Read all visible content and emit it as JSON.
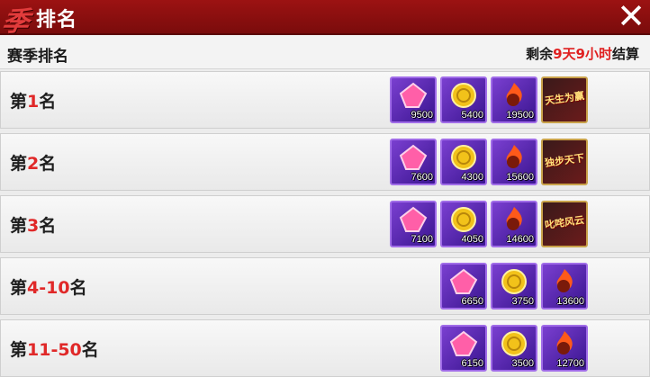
{
  "header": {
    "logo_char": "季",
    "title": "排名",
    "close_icon": "close-icon"
  },
  "subheader": {
    "label": "赛季排名",
    "remain_prefix": "剩余",
    "remain_days": "9天",
    "remain_hours": "9小时",
    "remain_suffix": "结算"
  },
  "rows": [
    {
      "rank_prefix": "第",
      "rank_num": "1",
      "rank_suffix": "名",
      "items": [
        {
          "icon": "pink-crystal-icon",
          "count": "9500"
        },
        {
          "icon": "gold-coin-icon",
          "count": "5400"
        },
        {
          "icon": "fire-orb-icon",
          "count": "19500"
        }
      ],
      "title_badge": "天生为赢"
    },
    {
      "rank_prefix": "第",
      "rank_num": "2",
      "rank_suffix": "名",
      "items": [
        {
          "icon": "pink-crystal-icon",
          "count": "7600"
        },
        {
          "icon": "gold-coin-icon",
          "count": "4300"
        },
        {
          "icon": "fire-orb-icon",
          "count": "15600"
        }
      ],
      "title_badge": "独步天下"
    },
    {
      "rank_prefix": "第",
      "rank_num": "3",
      "rank_suffix": "名",
      "items": [
        {
          "icon": "pink-crystal-icon",
          "count": "7100"
        },
        {
          "icon": "gold-coin-icon",
          "count": "4050"
        },
        {
          "icon": "fire-orb-icon",
          "count": "14600"
        }
      ],
      "title_badge": "叱咤风云"
    },
    {
      "rank_prefix": "第",
      "rank_num": "4-10",
      "rank_suffix": "名",
      "items": [
        {
          "icon": "pink-crystal-icon",
          "count": "6650"
        },
        {
          "icon": "gold-coin-icon",
          "count": "3750"
        },
        {
          "icon": "fire-orb-icon",
          "count": "13600"
        }
      ]
    },
    {
      "rank_prefix": "第",
      "rank_num": "11-50",
      "rank_suffix": "名",
      "items": [
        {
          "icon": "pink-crystal-icon",
          "count": "6150"
        },
        {
          "icon": "gold-coin-icon",
          "count": "3500"
        },
        {
          "icon": "fire-orb-icon",
          "count": "12700"
        }
      ]
    }
  ],
  "colors": {
    "header_red": "#8a0f0f",
    "highlight_red": "#e02020",
    "item_purple": "#5a2ab0"
  }
}
